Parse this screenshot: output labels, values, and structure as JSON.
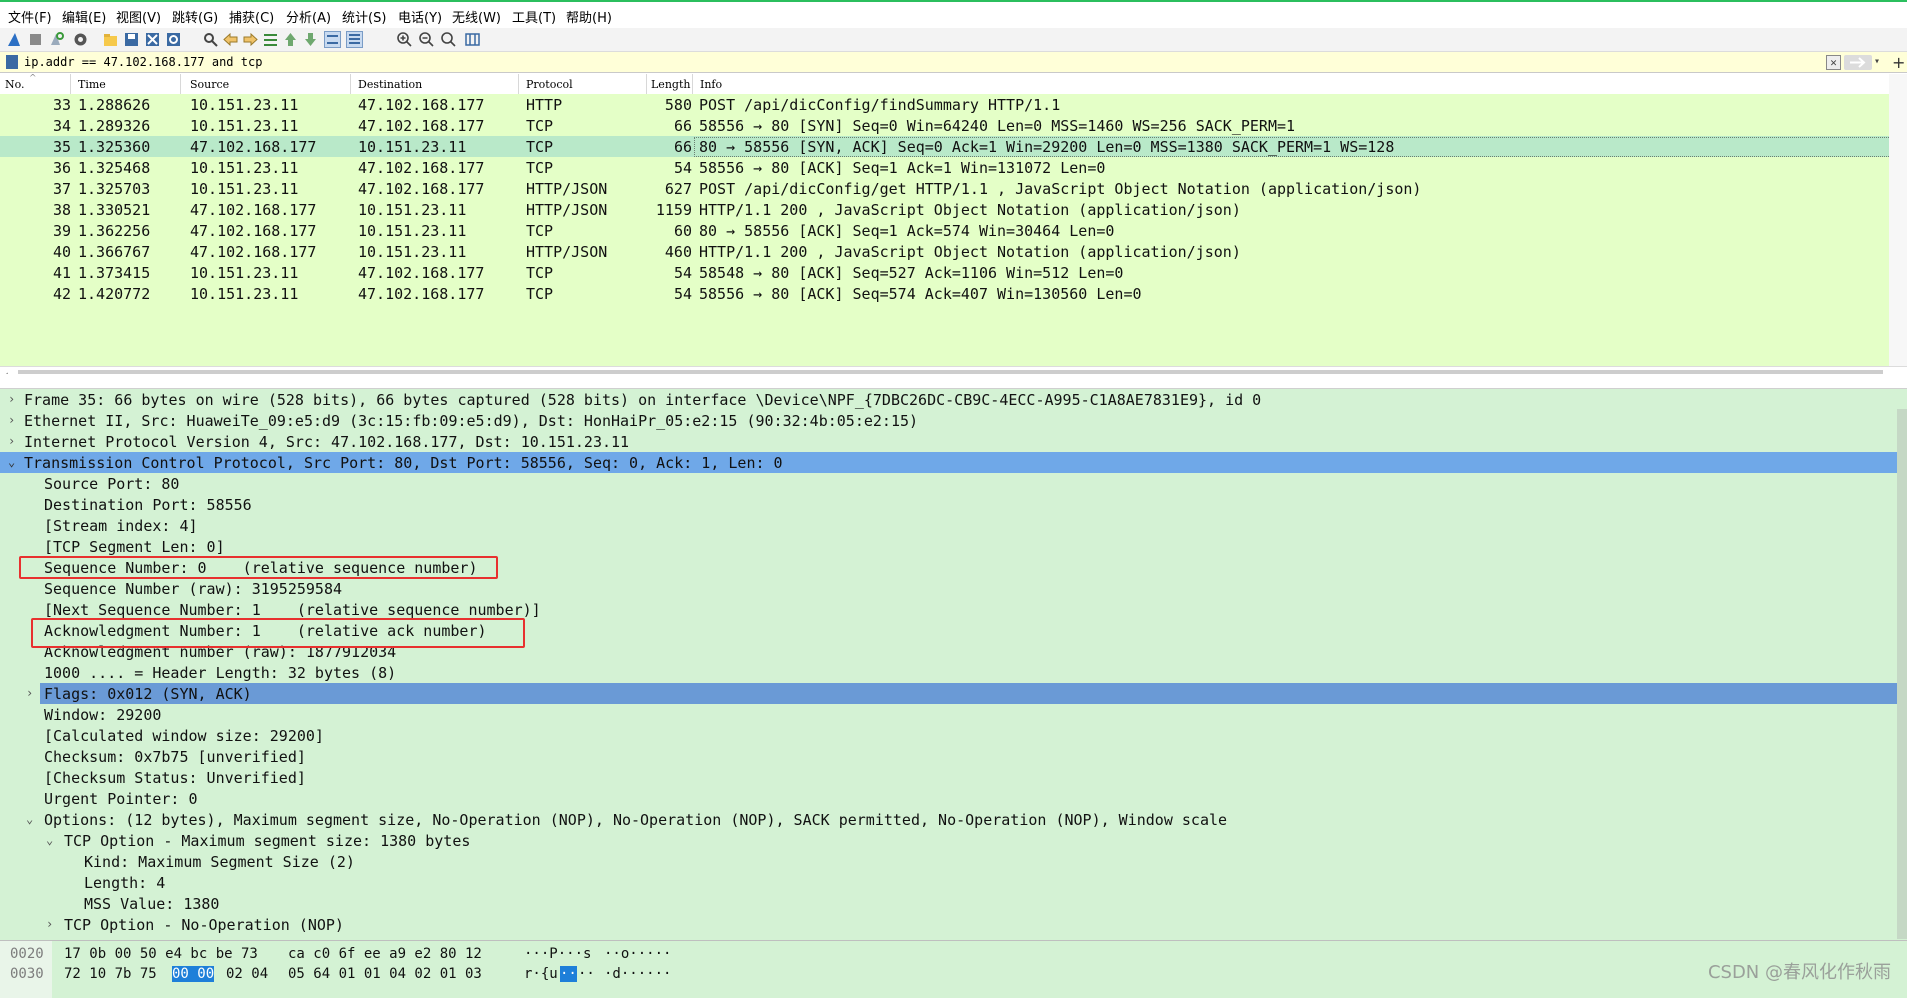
{
  "menu": [
    "文件(F)",
    "编辑(E)",
    "视图(V)",
    "跳转(G)",
    "捕获(C)",
    "分析(A)",
    "统计(S)",
    "电话(Y)",
    "无线(W)",
    "工具(T)",
    "帮助(H)"
  ],
  "toolbar_icons": [
    "shark-fin-start-icon",
    "stop-square-icon",
    "restart-capture-icon",
    "capture-options-gear-icon",
    "open-folder-icon",
    "save-file-icon",
    "close-file-icon",
    "reload-file-icon",
    "find-packet-icon",
    "go-back-arrow-icon",
    "go-forward-arrow-icon",
    "go-to-packet-icon",
    "go-first-icon",
    "go-last-icon",
    "autoscroll-icon",
    "colorize-icon",
    "zoom-in-icon",
    "zoom-out-icon",
    "zoom-normal-icon",
    "resize-columns-icon"
  ],
  "filter": {
    "value": "ip.addr == 47.102.168.177 and tcp"
  },
  "columns": [
    "No.",
    "Time",
    "Source",
    "Destination",
    "Protocol",
    "Length",
    "Info"
  ],
  "packets": [
    {
      "no": "33",
      "time": "1.288626",
      "src": "10.151.23.11",
      "dst": "47.102.168.177",
      "proto": "HTTP",
      "len": "580",
      "info": "POST /api/dicConfig/findSummary HTTP/1.1"
    },
    {
      "no": "34",
      "time": "1.289326",
      "src": "10.151.23.11",
      "dst": "47.102.168.177",
      "proto": "TCP",
      "len": "66",
      "info": "58556 → 80 [SYN] Seq=0 Win=64240 Len=0 MSS=1460 WS=256 SACK_PERM=1"
    },
    {
      "no": "35",
      "time": "1.325360",
      "src": "47.102.168.177",
      "dst": "10.151.23.11",
      "proto": "TCP",
      "len": "66",
      "info": "80 → 58556 [SYN, ACK] Seq=0 Ack=1 Win=29200 Len=0 MSS=1380 SACK_PERM=1 WS=128"
    },
    {
      "no": "36",
      "time": "1.325468",
      "src": "10.151.23.11",
      "dst": "47.102.168.177",
      "proto": "TCP",
      "len": "54",
      "info": "58556 → 80 [ACK] Seq=1 Ack=1 Win=131072 Len=0"
    },
    {
      "no": "37",
      "time": "1.325703",
      "src": "10.151.23.11",
      "dst": "47.102.168.177",
      "proto": "HTTP/JSON",
      "len": "627",
      "info": "POST /api/dicConfig/get HTTP/1.1 , JavaScript Object Notation (application/json)"
    },
    {
      "no": "38",
      "time": "1.330521",
      "src": "47.102.168.177",
      "dst": "10.151.23.11",
      "proto": "HTTP/JSON",
      "len": "1159",
      "info": "HTTP/1.1 200  , JavaScript Object Notation (application/json)"
    },
    {
      "no": "39",
      "time": "1.362256",
      "src": "47.102.168.177",
      "dst": "10.151.23.11",
      "proto": "TCP",
      "len": "60",
      "info": "80 → 58556 [ACK] Seq=1 Ack=574 Win=30464 Len=0"
    },
    {
      "no": "40",
      "time": "1.366767",
      "src": "47.102.168.177",
      "dst": "10.151.23.11",
      "proto": "HTTP/JSON",
      "len": "460",
      "info": "HTTP/1.1 200  , JavaScript Object Notation (application/json)"
    },
    {
      "no": "41",
      "time": "1.373415",
      "src": "10.151.23.11",
      "dst": "47.102.168.177",
      "proto": "TCP",
      "len": "54",
      "info": "58548 → 80 [ACK] Seq=527 Ack=1106 Win=512 Len=0"
    },
    {
      "no": "42",
      "time": "1.420772",
      "src": "10.151.23.11",
      "dst": "47.102.168.177",
      "proto": "TCP",
      "len": "54",
      "info": "58556 → 80 [ACK] Seq=574 Ack=407 Win=130560 Len=0"
    }
  ],
  "details": [
    {
      "text": "Frame 35: 66 bytes on wire (528 bits), 66 bytes captured (528 bits) on interface \\Device\\NPF_{7DBC26DC-CB9C-4ECC-A995-C1A8AE7831E9}, id 0",
      "expander": "›"
    },
    {
      "text": "Ethernet II, Src: HuaweiTe_09:e5:d9 (3c:15:fb:09:e5:d9), Dst: HonHaiPr_05:e2:15 (90:32:4b:05:e2:15)",
      "expander": "›"
    },
    {
      "text": "Internet Protocol Version 4, Src: 47.102.168.177, Dst: 10.151.23.11",
      "expander": "›"
    },
    {
      "text": "Transmission Control Protocol, Src Port: 80, Dst Port: 58556, Seq: 0, Ack: 1, Len: 0",
      "expander": "⌄"
    },
    {
      "text": "Source Port: 80",
      "expander": ""
    },
    {
      "text": "Destination Port: 58556",
      "expander": ""
    },
    {
      "text": "[Stream index: 4]",
      "expander": ""
    },
    {
      "text": "[TCP Segment Len: 0]",
      "expander": ""
    },
    {
      "text": "Sequence Number: 0    (relative sequence number)",
      "expander": ""
    },
    {
      "text": "Sequence Number (raw): 3195259584",
      "expander": ""
    },
    {
      "text": "[Next Sequence Number: 1    (relative sequence number)]",
      "expander": ""
    },
    {
      "text": "Acknowledgment Number: 1    (relative ack number)",
      "expander": ""
    },
    {
      "text": "Acknowledgment number (raw): 1877912034",
      "expander": ""
    },
    {
      "text": "1000 .... = Header Length: 32 bytes (8)",
      "expander": ""
    },
    {
      "text": "Flags: 0x012 (SYN, ACK)",
      "expander": "›"
    },
    {
      "text": "Window: 29200",
      "expander": ""
    },
    {
      "text": "[Calculated window size: 29200]",
      "expander": ""
    },
    {
      "text": "Checksum: 0x7b75 [unverified]",
      "expander": ""
    },
    {
      "text": "[Checksum Status: Unverified]",
      "expander": ""
    },
    {
      "text": "Urgent Pointer: 0",
      "expander": ""
    },
    {
      "text": "Options: (12 bytes), Maximum segment size, No-Operation (NOP), No-Operation (NOP), SACK permitted, No-Operation (NOP), Window scale",
      "expander": "⌄"
    },
    {
      "text": "TCP Option - Maximum segment size: 1380 bytes",
      "expander": "⌄"
    },
    {
      "text": "Kind: Maximum Segment Size (2)",
      "expander": ""
    },
    {
      "text": "Length: 4",
      "expander": ""
    },
    {
      "text": "MSS Value: 1380",
      "expander": ""
    },
    {
      "text": "TCP Option - No-Operation (NOP)",
      "expander": "›"
    }
  ],
  "bytes": [
    {
      "offset": "0020",
      "hex_a": "17 0b 00 50 e4 bc be 73",
      "hex_b": "ca c0 6f ee a9 e2 80 12",
      "ascii_a": "···P···s",
      "ascii_b": "··o·····"
    },
    {
      "offset": "0030",
      "hex_a_pre": "72 10 7b 75",
      "hex_hl": "00 00",
      "hex_a_post": "02 04",
      "hex_b": "05 64 01 01 04 02 01 03",
      "ascii_a_pre": "r·{u",
      "ascii_hl": "··",
      "ascii_a_post": "··",
      "ascii_b": "·d······"
    }
  ],
  "watermark": "CSDN @春风化作秋雨"
}
